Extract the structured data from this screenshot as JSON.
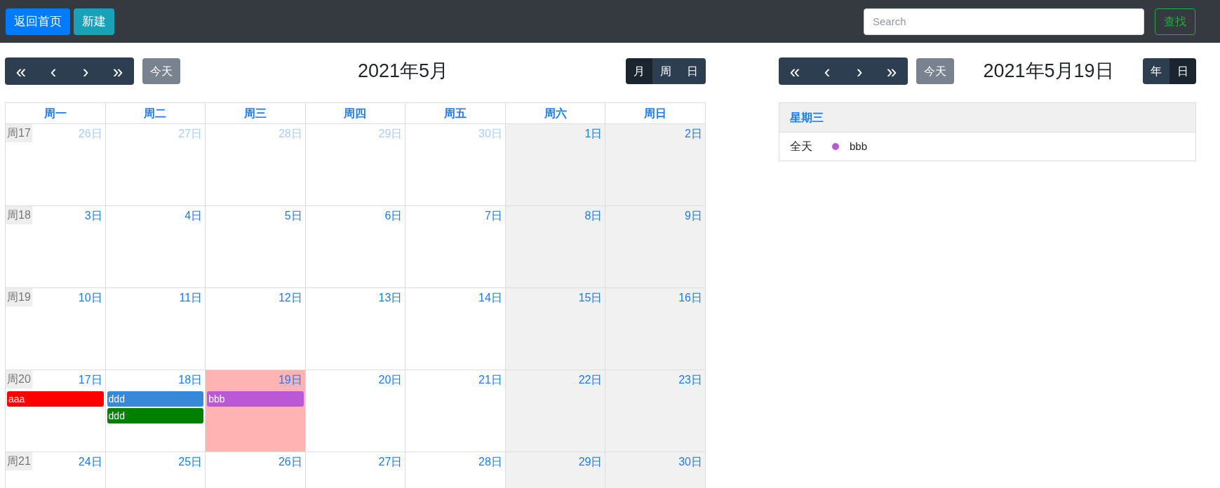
{
  "navbar": {
    "buttons": [
      {
        "label": "返回首页",
        "kind": "primary"
      },
      {
        "label": "新建",
        "kind": "info"
      }
    ],
    "search": {
      "placeholder": "Search"
    },
    "search_button": "查找"
  },
  "month_calendar": {
    "nav": [
      "«",
      "‹",
      "›",
      "»"
    ],
    "today_button": "今天",
    "title": "2021年5月",
    "views": [
      {
        "label": "月",
        "selected": true
      },
      {
        "label": "周",
        "selected": false
      },
      {
        "label": "日",
        "selected": false
      }
    ],
    "weekdays": [
      "周一",
      "周二",
      "周三",
      "周四",
      "周五",
      "周六",
      "周日"
    ],
    "weeks": [
      {
        "week": "周17",
        "days": [
          {
            "date": "26日",
            "other_month": true,
            "today": false
          },
          {
            "date": "27日",
            "other_month": true,
            "today": false
          },
          {
            "date": "28日",
            "other_month": true,
            "today": false
          },
          {
            "date": "29日",
            "other_month": true,
            "today": false
          },
          {
            "date": "30日",
            "other_month": true,
            "today": false
          },
          {
            "date": "1日",
            "other_month": false,
            "today": false
          },
          {
            "date": "2日",
            "other_month": false,
            "today": false
          }
        ]
      },
      {
        "week": "周18",
        "days": [
          {
            "date": "3日",
            "other_month": false,
            "today": false
          },
          {
            "date": "4日",
            "other_month": false,
            "today": false
          },
          {
            "date": "5日",
            "other_month": false,
            "today": false
          },
          {
            "date": "6日",
            "other_month": false,
            "today": false
          },
          {
            "date": "7日",
            "other_month": false,
            "today": false
          },
          {
            "date": "8日",
            "other_month": false,
            "today": false
          },
          {
            "date": "9日",
            "other_month": false,
            "today": false
          }
        ]
      },
      {
        "week": "周19",
        "days": [
          {
            "date": "10日",
            "other_month": false,
            "today": false
          },
          {
            "date": "11日",
            "other_month": false,
            "today": false
          },
          {
            "date": "12日",
            "other_month": false,
            "today": false
          },
          {
            "date": "13日",
            "other_month": false,
            "today": false
          },
          {
            "date": "14日",
            "other_month": false,
            "today": false
          },
          {
            "date": "15日",
            "other_month": false,
            "today": false
          },
          {
            "date": "16日",
            "other_month": false,
            "today": false
          }
        ]
      },
      {
        "week": "周20",
        "days": [
          {
            "date": "17日",
            "other_month": false,
            "today": false,
            "events": [
              {
                "title": "aaa",
                "color": "#ff0000"
              }
            ]
          },
          {
            "date": "18日",
            "other_month": false,
            "today": false,
            "events": [
              {
                "title": "ddd",
                "color": "#3788d8"
              },
              {
                "title": "ddd",
                "color": "#008000"
              }
            ]
          },
          {
            "date": "19日",
            "other_month": false,
            "today": true,
            "events": [
              {
                "title": "bbb",
                "color": "#bb58d6"
              }
            ]
          },
          {
            "date": "20日",
            "other_month": false,
            "today": false
          },
          {
            "date": "21日",
            "other_month": false,
            "today": false
          },
          {
            "date": "22日",
            "other_month": false,
            "today": false
          },
          {
            "date": "23日",
            "other_month": false,
            "today": false
          }
        ]
      },
      {
        "week": "周21",
        "days": [
          {
            "date": "24日",
            "other_month": false,
            "today": false
          },
          {
            "date": "25日",
            "other_month": false,
            "today": false
          },
          {
            "date": "26日",
            "other_month": false,
            "today": false
          },
          {
            "date": "27日",
            "other_month": false,
            "today": false
          },
          {
            "date": "28日",
            "other_month": false,
            "today": false
          },
          {
            "date": "29日",
            "other_month": false,
            "today": false
          },
          {
            "date": "30日",
            "other_month": false,
            "today": false
          }
        ]
      }
    ]
  },
  "day_calendar": {
    "nav": [
      "«",
      "‹",
      "›",
      "»"
    ],
    "today_button": "今天",
    "title": "2021年5月19日",
    "views": [
      {
        "label": "年",
        "selected": false
      },
      {
        "label": "日",
        "selected": true
      }
    ],
    "weekday": "星期三",
    "events": [
      {
        "time": "全天",
        "title": "bbb",
        "color": "#bb58d6"
      }
    ]
  }
}
